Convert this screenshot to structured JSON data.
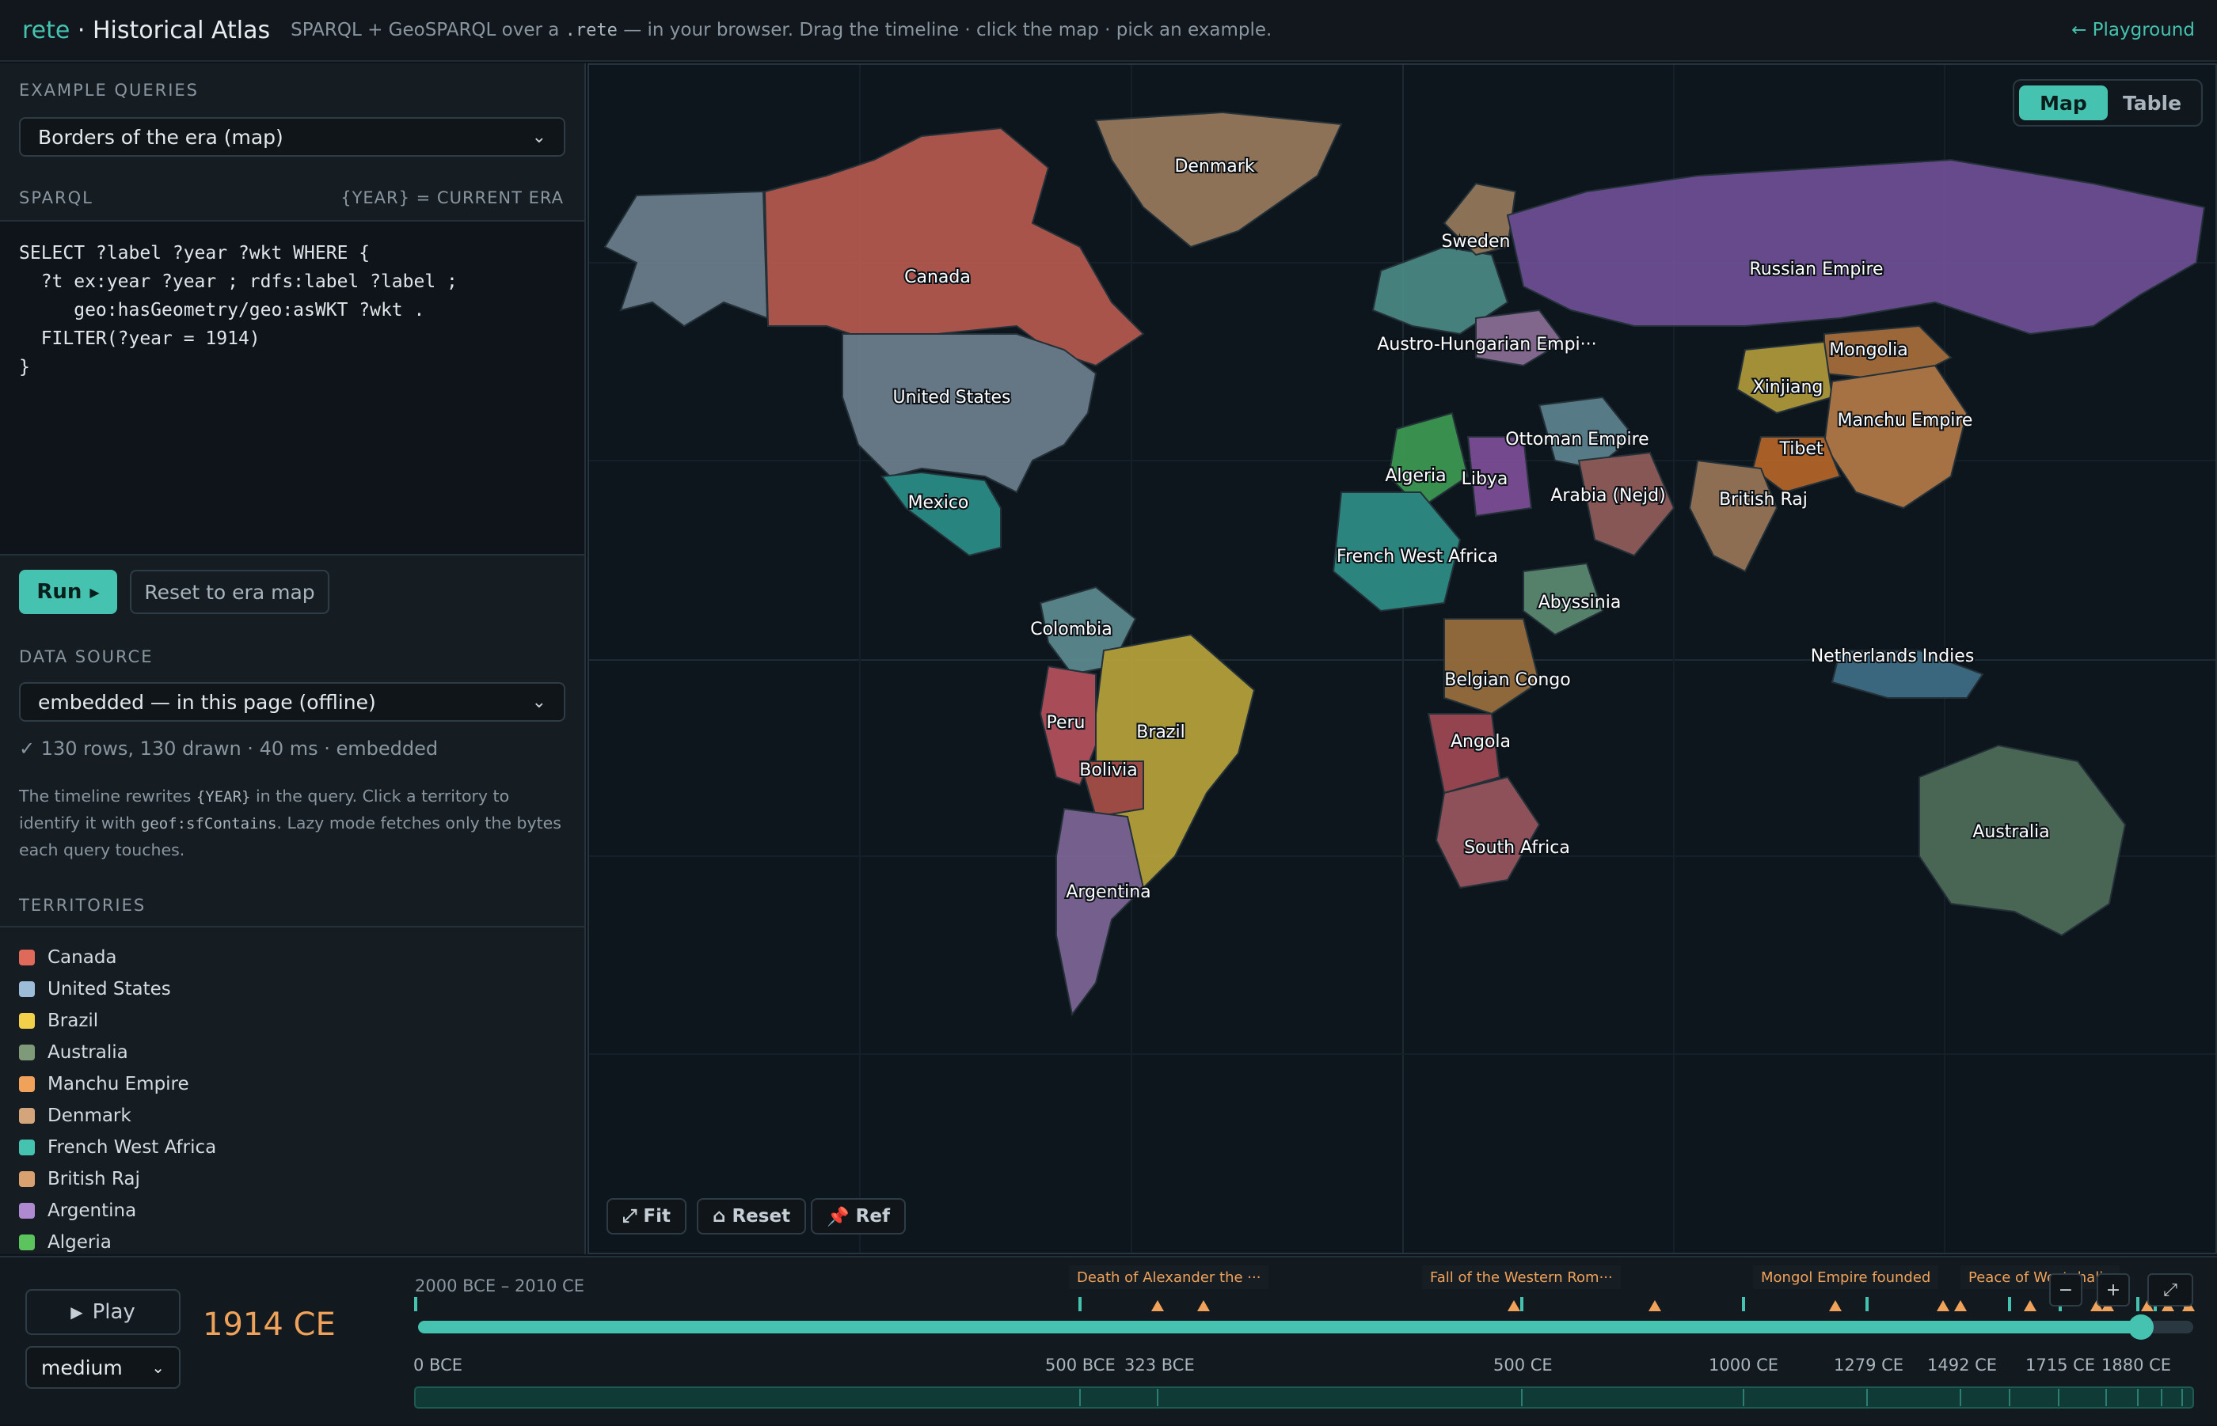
{
  "header": {
    "brand": "rete",
    "brand_rest": " · Historical Atlas",
    "subtitle_a": "SPARQL + GeoSPARQL over a ",
    "subtitle_code": ".rete",
    "subtitle_b": " — in your browser. Drag the timeline · click the map · pick an example.",
    "playground": "← Playground"
  },
  "sidebar": {
    "examples_heading": "EXAMPLE QUERIES",
    "example_selected": "Borders of the era (map)",
    "sparql_heading": "SPARQL",
    "sparql_hint": "{YEAR} = CURRENT ERA",
    "query": "SELECT ?label ?year ?wkt WHERE {\n  ?t ex:year ?year ; rdfs:label ?label ;\n     geo:hasGeometry/geo:asWKT ?wkt .\n  FILTER(?year = 1914)\n}",
    "run_label": "Run",
    "reset_label": "Reset to era map",
    "datasource_heading": "DATA SOURCE",
    "datasource_selected": "embedded — in this page (offline)",
    "status": "✓ 130 rows, 130 drawn · 40 ms · embedded",
    "help_a": "The timeline rewrites ",
    "help_code1": "{YEAR}",
    "help_b": " in the query. Click a territory to identify it with ",
    "help_code2": "geof:sfContains",
    "help_c": ". Lazy mode fetches only the bytes each query touches.",
    "territories_heading": "TERRITORIES",
    "territories": [
      {
        "name": "Canada",
        "color": "#e06a5a"
      },
      {
        "name": "United States",
        "color": "#9dbcd8"
      },
      {
        "name": "Brazil",
        "color": "#f2d04a"
      },
      {
        "name": "Australia",
        "color": "#7f9a78"
      },
      {
        "name": "Manchu Empire",
        "color": "#f0a25a"
      },
      {
        "name": "Denmark",
        "color": "#d4a57a"
      },
      {
        "name": "French West Africa",
        "color": "#45c2b0"
      },
      {
        "name": "British Raj",
        "color": "#d9a070"
      },
      {
        "name": "Argentina",
        "color": "#b08ad0"
      },
      {
        "name": "Algeria",
        "color": "#5cc45c"
      }
    ]
  },
  "map": {
    "tab_map": "Map",
    "tab_table": "Table",
    "fit": "Fit",
    "reset": "Reset",
    "ref": "Ref",
    "labels": [
      "Denmark",
      "Canada",
      "Sweden",
      "Russian Empire",
      "Austro-Hungarian Empi···",
      "Mongolia",
      "United States",
      "Xinjiang",
      "Manchu Empire",
      "Ottoman Empire",
      "Algeria",
      "Libya",
      "Tibet",
      "Arabia (Nejd)",
      "British Raj",
      "Mexico",
      "French West Africa",
      "Abyssinia",
      "Colombia",
      "Netherlands Indies",
      "Belgian Congo",
      "Peru",
      "Brazil",
      "Angola",
      "Bolivia",
      "Australia",
      "South Africa",
      "Argentina"
    ]
  },
  "timeline": {
    "play": "Play",
    "speed": "medium",
    "current_year": "1914 CE",
    "range": "2000 BCE – 2010 CE",
    "events": [
      "Death of Alexander the ···",
      "Fall of the Western Rom···",
      "Mongol Empire founded",
      "Peace of Westphalia"
    ],
    "ticks": [
      "0 BCE",
      "500 BCE",
      "323 BCE",
      "500 CE",
      "1000 CE",
      "1279 CE",
      "1492 CE",
      "1715 CE",
      "1880 CE"
    ],
    "zoom_out": "−",
    "zoom_in": "+",
    "expand": "⤢"
  }
}
